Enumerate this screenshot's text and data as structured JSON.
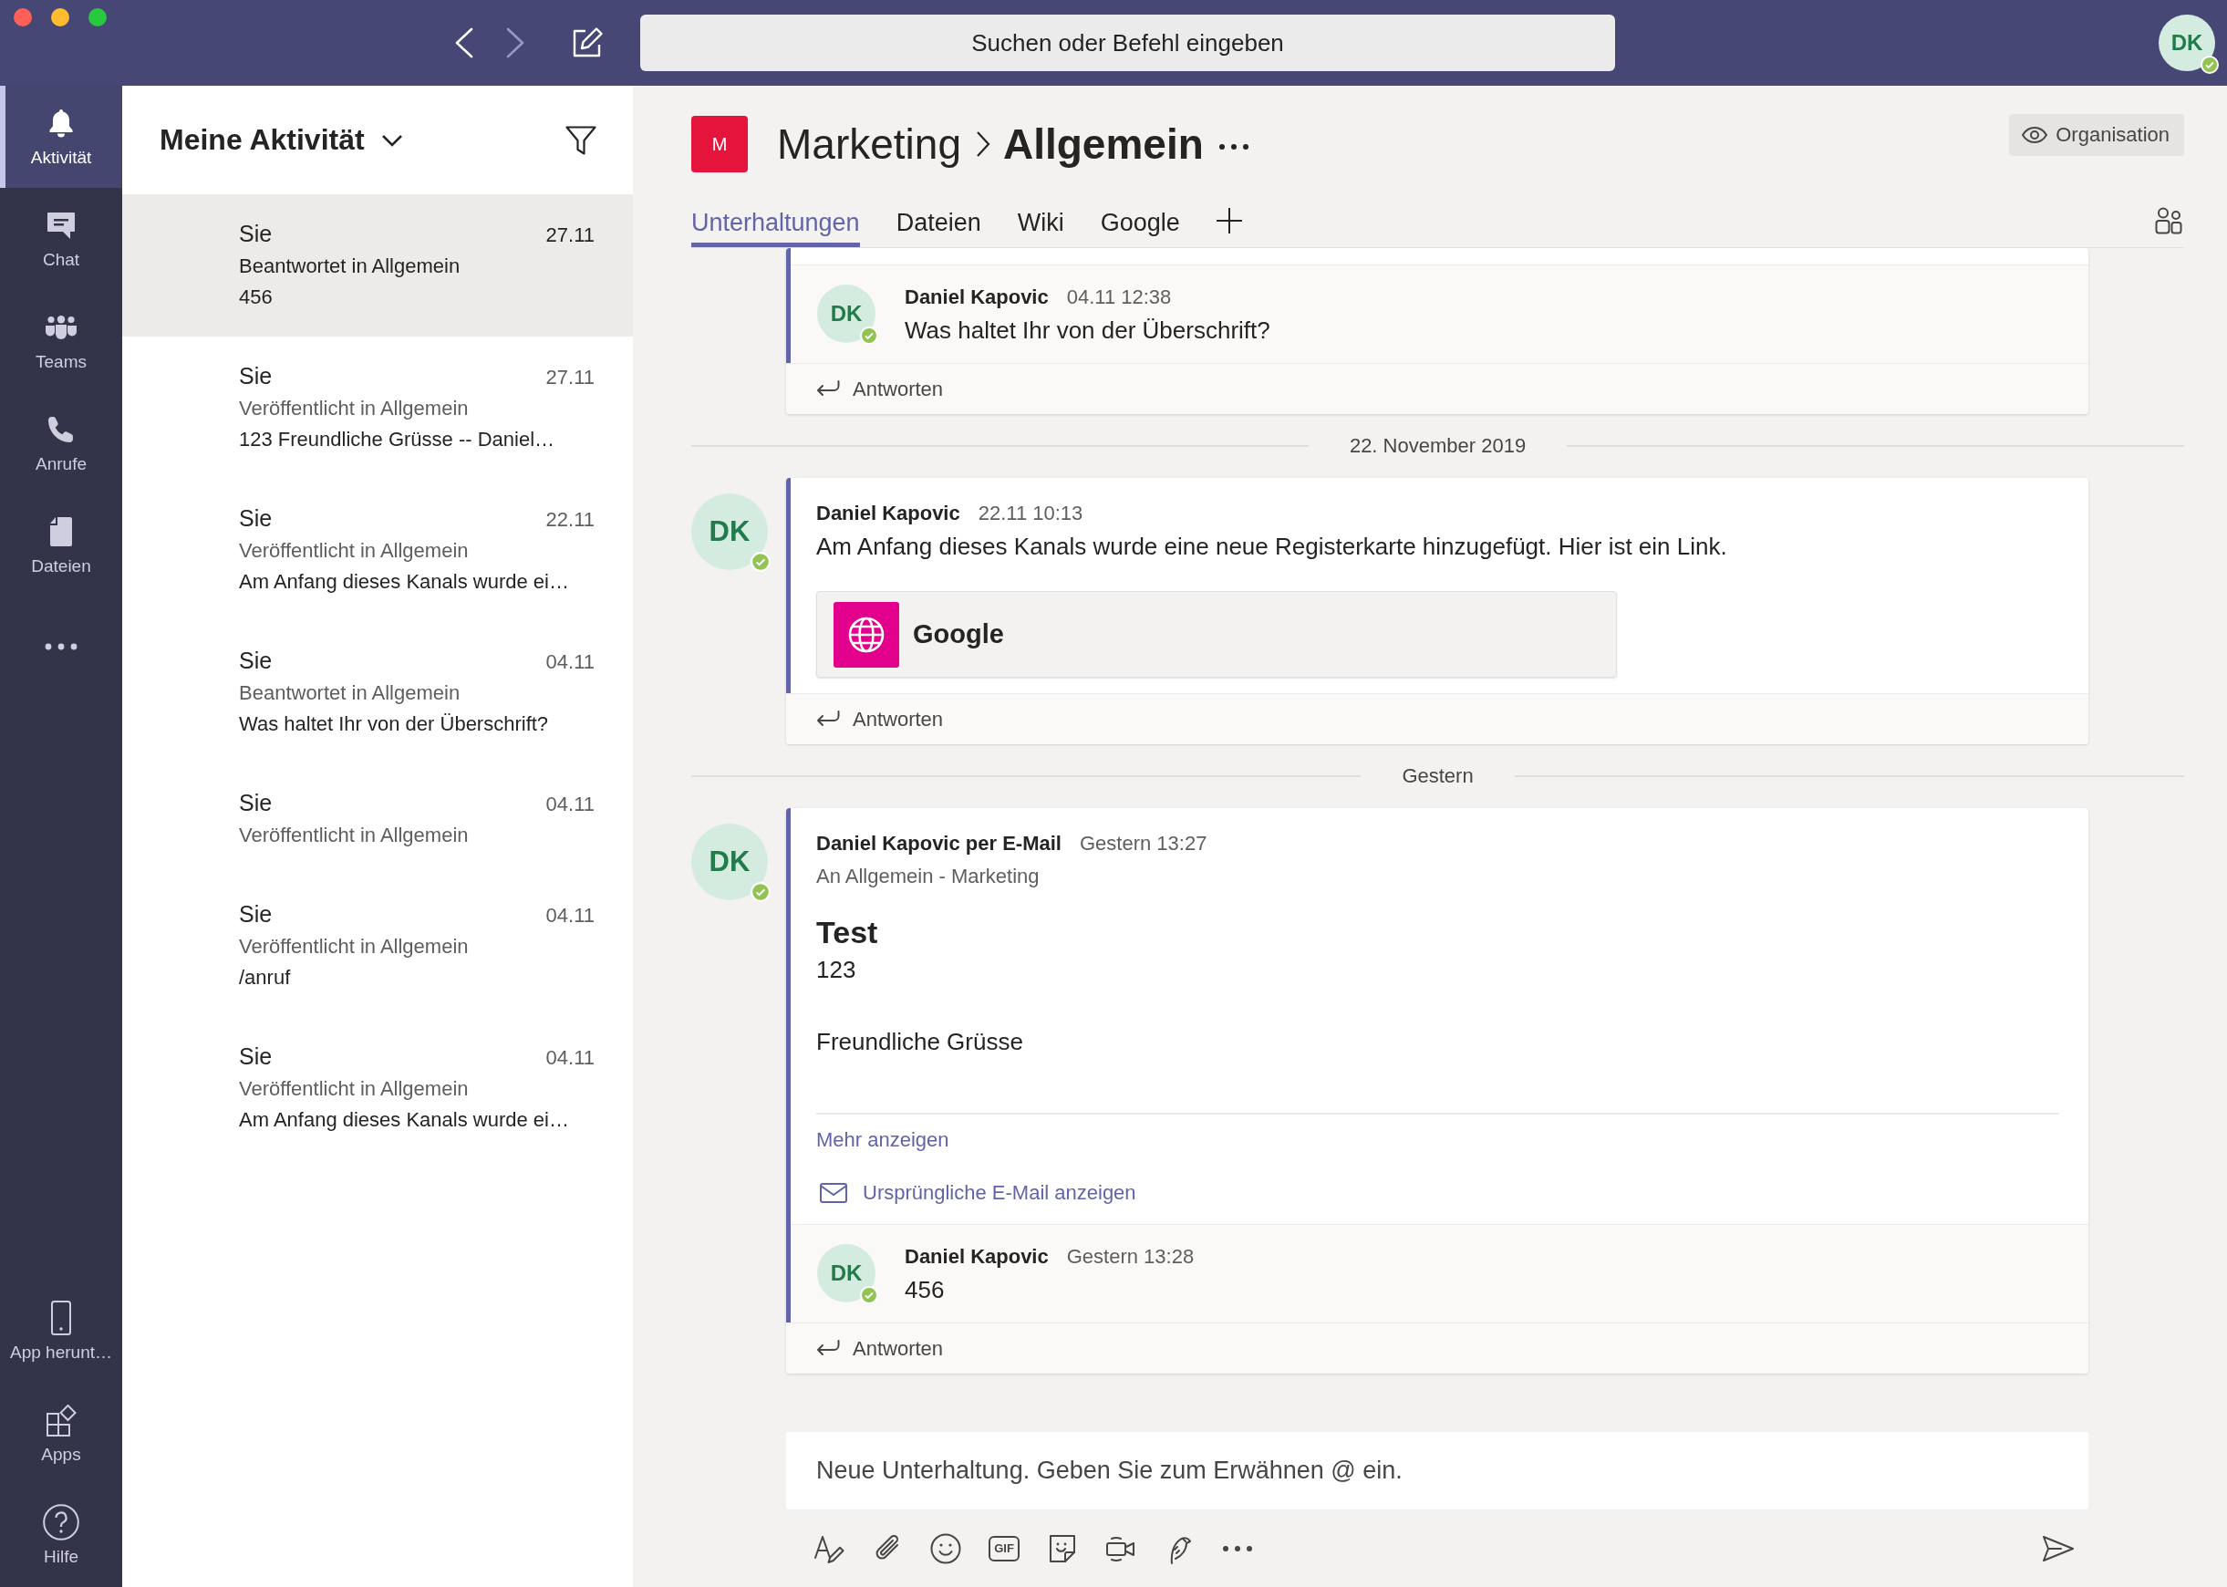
{
  "window": {
    "navigation": {
      "back": {
        "disabled": false
      },
      "forward": {
        "disabled": true
      }
    },
    "search": {
      "placeholder": "Suchen oder Befehl eingeben"
    },
    "profile": {
      "initials": "DK",
      "online": true
    }
  },
  "rail": {
    "items": [
      {
        "kind": "activity",
        "label": "Aktivität",
        "selected": true
      },
      {
        "kind": "chat",
        "label": "Chat",
        "selected": false
      },
      {
        "kind": "teams",
        "label": "Teams",
        "selected": false
      },
      {
        "kind": "calls",
        "label": "Anrufe",
        "selected": false
      },
      {
        "kind": "files",
        "label": "Dateien",
        "selected": false
      },
      {
        "kind": "more",
        "selected": false
      }
    ],
    "bottom_items": [
      {
        "kind": "download",
        "label": "App herunt…",
        "selected": false
      },
      {
        "kind": "apps",
        "label": "Apps",
        "selected": false
      },
      {
        "kind": "help",
        "label": "Hilfe",
        "selected": false
      }
    ]
  },
  "activity": {
    "title": "Meine Aktivität",
    "items": [
      {
        "author": "Sie",
        "date": "27.11",
        "action": "Beantwortet in Allgemein",
        "preview": "456",
        "selected": true
      },
      {
        "author": "Sie",
        "date": "27.11",
        "action": "Veröffentlicht in Allgemein",
        "preview": "123 Freundliche Grüsse -- Daniel…",
        "selected": false
      },
      {
        "author": "Sie",
        "date": "22.11",
        "action": "Veröffentlicht in Allgemein",
        "preview": "Am Anfang dieses Kanals wurde ei…",
        "selected": false
      },
      {
        "author": "Sie",
        "date": "04.11",
        "action": "Beantwortet in Allgemein",
        "preview": "Was haltet Ihr von der Überschrift?",
        "selected": false
      },
      {
        "author": "Sie",
        "date": "04.11",
        "action": "Veröffentlicht in Allgemein",
        "selected": false
      },
      {
        "author": "Sie",
        "date": "04.11",
        "action": "Veröffentlicht in Allgemein",
        "preview": "/anruf",
        "selected": false
      },
      {
        "author": "Sie",
        "date": "04.11",
        "action": "Veröffentlicht in Allgemein",
        "preview": "Am Anfang dieses Kanals wurde ei…",
        "selected": false
      }
    ]
  },
  "channel": {
    "team_initial": "M",
    "team_name": "Marketing",
    "channel_name": "Allgemein",
    "organisation_button": "Organisation",
    "tabs": [
      {
        "label": "Unterhaltungen",
        "selected": true
      },
      {
        "label": "Dateien",
        "selected": false
      },
      {
        "label": "Wiki",
        "selected": false
      },
      {
        "label": "Google",
        "selected": false
      }
    ]
  },
  "conversation": [
    {
      "kind": "thread",
      "replies": [
        {
          "author": "Daniel Kapovic",
          "time": "04.11 12:38",
          "text": "Was haltet Ihr von der Überschrift?",
          "avatar": {
            "initials": "DK",
            "online": true
          }
        }
      ],
      "reply_action": "Antworten"
    },
    {
      "kind": "divider",
      "label": "22. November 2019"
    },
    {
      "kind": "thread",
      "post": {
        "author": "Daniel Kapovic",
        "time": "22.11 10:13",
        "avatar": {
          "initials": "DK",
          "online": true
        },
        "text": "Am Anfang dieses Kanals wurde eine neue Registerkarte hinzugefügt. Hier ist ein Link.",
        "link_card": {
          "title": "Google"
        }
      },
      "reply_action": "Antworten"
    },
    {
      "kind": "divider",
      "label": "Gestern"
    },
    {
      "kind": "thread",
      "post": {
        "author": "Daniel Kapovic per E-Mail",
        "time": "Gestern 13:27",
        "avatar": {
          "initials": "DK",
          "online": true
        },
        "recipient": "An Allgemein - Marketing",
        "subject": "Test",
        "paragraphs": [
          "123",
          "Freundliche Grüsse"
        ],
        "more_link": "Mehr anzeigen",
        "email_link": "Ursprüngliche E-Mail anzeigen"
      },
      "replies": [
        {
          "author": "Daniel Kapovic",
          "time": "Gestern 13:28",
          "text": "456",
          "avatar": {
            "initials": "DK",
            "online": true
          }
        }
      ],
      "reply_action": "Antworten"
    }
  ],
  "compose": {
    "placeholder": "Neue Unterhaltung. Geben Sie zum Erwähnen @ ein.",
    "tools": [
      {
        "kind": "format"
      },
      {
        "kind": "attach"
      },
      {
        "kind": "emoji"
      },
      {
        "kind": "gif",
        "label": "GIF"
      },
      {
        "kind": "sticker"
      },
      {
        "kind": "meet"
      },
      {
        "kind": "praise"
      },
      {
        "kind": "more"
      }
    ]
  }
}
